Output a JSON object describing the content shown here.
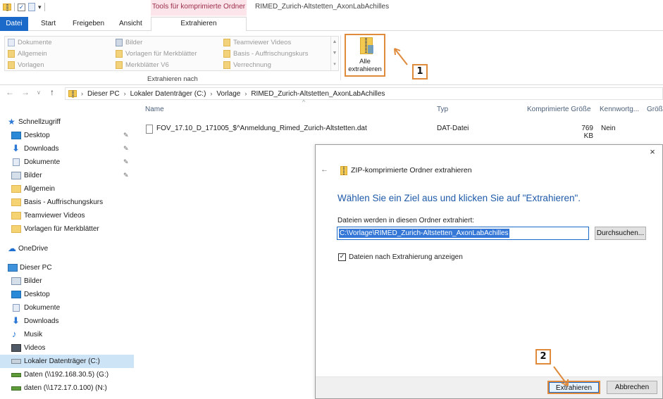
{
  "titlebar": {
    "context_tab_header": "Tools für komprimierte Ordner",
    "window_title": "RIMED_Zurich-Altstetten_AxonLabAchilles"
  },
  "ribbon_tabs": [
    {
      "label": "Datei"
    },
    {
      "label": "Start"
    },
    {
      "label": "Freigeben"
    },
    {
      "label": "Ansicht"
    },
    {
      "label": "Extrahieren"
    }
  ],
  "ribbon": {
    "gallery": [
      {
        "label": "Dokumente",
        "icon": "document-icon"
      },
      {
        "label": "Allgemein",
        "icon": "folder-icon"
      },
      {
        "label": "Vorlagen",
        "icon": "folder-icon"
      },
      {
        "label": "Bilder",
        "icon": "pictures-icon"
      },
      {
        "label": "Vorlagen für Merkblätter",
        "icon": "folder-icon"
      },
      {
        "label": "Merkblätter V6",
        "icon": "folder-icon"
      },
      {
        "label": "Teamviewer Videos",
        "icon": "folder-icon"
      },
      {
        "label": "Basis - Auffrischungskurs",
        "icon": "folder-icon"
      },
      {
        "label": "Verrechnung",
        "icon": "folder-icon"
      }
    ],
    "group_label": "Extrahieren nach",
    "extract_all_line1": "Alle",
    "extract_all_line2": "extrahieren"
  },
  "annotations": {
    "badge1": "1",
    "badge2": "2",
    "color": "#e08a3c"
  },
  "address": {
    "crumbs": [
      "Dieser PC",
      "Lokaler Datenträger (C:)",
      "Vorlage",
      "RIMED_Zurich-Altstetten_AxonLabAchilles"
    ]
  },
  "nav": {
    "quick_access": "Schnellzugriff",
    "items": [
      {
        "label": "Desktop",
        "icon": "desktop-icon",
        "pinned": true
      },
      {
        "label": "Downloads",
        "icon": "download-icon",
        "pinned": true
      },
      {
        "label": "Dokumente",
        "icon": "document-icon",
        "pinned": true
      },
      {
        "label": "Bilder",
        "icon": "pictures-icon",
        "pinned": true
      },
      {
        "label": "Allgemein",
        "icon": "folder-icon"
      },
      {
        "label": "Basis - Auffrischungskurs",
        "icon": "folder-icon"
      },
      {
        "label": "Teamviewer Videos",
        "icon": "folder-icon"
      },
      {
        "label": "Vorlagen für Merkblätter",
        "icon": "folder-icon"
      }
    ],
    "onedrive": "OneDrive",
    "this_pc": "Dieser PC",
    "pc_items": [
      {
        "label": "Bilder",
        "icon": "pictures-icon"
      },
      {
        "label": "Desktop",
        "icon": "desktop-icon"
      },
      {
        "label": "Dokumente",
        "icon": "document-icon"
      },
      {
        "label": "Downloads",
        "icon": "download-icon"
      },
      {
        "label": "Musik",
        "icon": "music-icon"
      },
      {
        "label": "Videos",
        "icon": "video-icon"
      },
      {
        "label": "Lokaler Datenträger (C:)",
        "icon": "drive-icon",
        "selected": true
      },
      {
        "label": "Daten (\\\\192.168.30.5) (G:)",
        "icon": "network-drive-icon"
      },
      {
        "label": "daten (\\\\172.17.0.100) (N:)",
        "icon": "network-drive-icon"
      }
    ]
  },
  "file_list": {
    "columns": [
      "Name",
      "Typ",
      "Komprimierte Größe",
      "Kennwortg...",
      "Größe"
    ],
    "rows": [
      {
        "name": "FOV_17.10_D_171005_$^Anmeldung_Rimed_Zurich-Altstetten.dat",
        "type": "DAT-Datei",
        "size": "769 KB",
        "password": "Nein"
      }
    ]
  },
  "dialog": {
    "close": "×",
    "title": "ZIP-komprimierte Ordner extrahieren",
    "heading": "Wählen Sie ein Ziel aus und klicken Sie auf \"Extrahieren\".",
    "target_label": "Dateien werden in diesen Ordner extrahiert:",
    "target_value": "C:\\Vorlage\\RIMED_Zurich-Altstetten_AxonLabAchilles",
    "browse_button": "Durchsuchen...",
    "show_files_checkbox": "Dateien nach Extrahierung anzeigen",
    "show_files_checked": true,
    "extract_button": "Extrahieren",
    "cancel_button": "Abbrechen"
  }
}
